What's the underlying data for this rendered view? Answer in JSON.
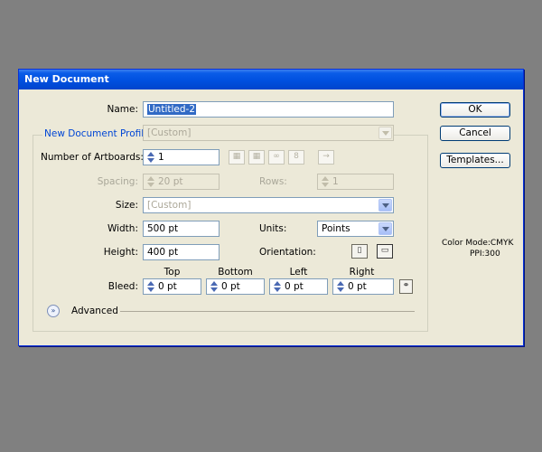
{
  "dialog": {
    "title": "New Document"
  },
  "name": {
    "label": "Name:",
    "value": "Untitled-2"
  },
  "profile": {
    "label": "New Document Profile:",
    "value": "[Custom]"
  },
  "artboards": {
    "label": "Number of Artboards:",
    "value": "1",
    "layout_icons": [
      "grid-by-row-icon",
      "grid-by-column-icon",
      "arrange-by-row-icon",
      "arrange-by-column-icon",
      "right-to-left-icon"
    ]
  },
  "spacing": {
    "label": "Spacing:",
    "value": "20 pt"
  },
  "rows": {
    "label": "Rows:",
    "value": "1"
  },
  "size": {
    "label": "Size:",
    "value": "[Custom]"
  },
  "width": {
    "label": "Width:",
    "value": "500 pt"
  },
  "units": {
    "label": "Units:",
    "value": "Points"
  },
  "height": {
    "label": "Height:",
    "value": "400 pt"
  },
  "orientation": {
    "label": "Orientation:",
    "options": [
      "portrait-icon",
      "landscape-icon"
    ]
  },
  "bleed": {
    "label": "Bleed:",
    "top": {
      "label": "Top",
      "value": "0 pt"
    },
    "bottom": {
      "label": "Bottom",
      "value": "0 pt"
    },
    "left": {
      "label": "Left",
      "value": "0 pt"
    },
    "right": {
      "label": "Right",
      "value": "0 pt"
    },
    "link_icon": "chain-link-icon"
  },
  "advanced": {
    "label": "Advanced"
  },
  "buttons": {
    "ok": "OK",
    "cancel": "Cancel",
    "templates": "Templates..."
  },
  "info": {
    "color_mode": "Color Mode:CMYK",
    "ppi": "PPI:300"
  },
  "colors": {
    "title_bar": "#0050e0",
    "dialog_bg": "#ece9d8",
    "desktop": "#808080",
    "selection": "#316ac5",
    "group_label": "#0046d5"
  }
}
